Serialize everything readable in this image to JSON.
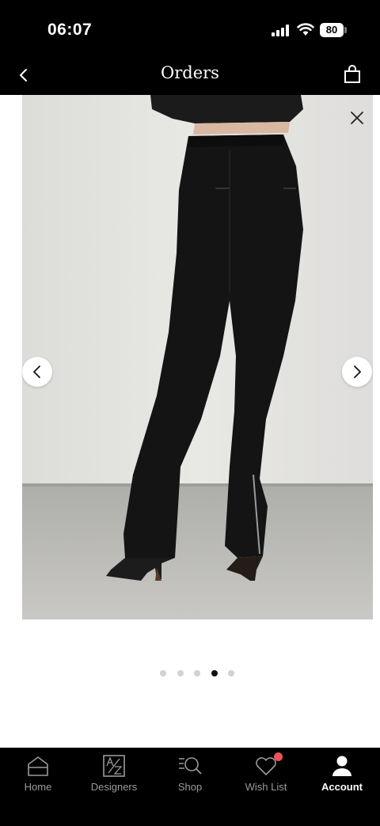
{
  "status_bar": {
    "time": "06:07",
    "battery": "80",
    "icons": [
      "signal-icon",
      "wifi-icon",
      "battery-icon"
    ]
  },
  "nav": {
    "title": "Orders",
    "back_icon": "chevron-left-icon",
    "bag_icon": "shopping-bag-icon"
  },
  "gallery": {
    "image_description_icon": "product-photo",
    "close_icon": "close-icon",
    "prev_icon": "chevron-left-icon",
    "next_icon": "chevron-right-icon",
    "total_images": 5,
    "active_index": 3
  },
  "tabs": [
    {
      "label": "Home",
      "icon": "home-icon",
      "active": false
    },
    {
      "label": "Designers",
      "icon": "a-z-icon",
      "active": false
    },
    {
      "label": "Shop",
      "icon": "search-list-icon",
      "active": false
    },
    {
      "label": "Wish List",
      "icon": "heart-icon",
      "active": false,
      "badge": true
    },
    {
      "label": "Account",
      "icon": "person-icon",
      "active": true
    }
  ],
  "colors": {
    "background": "#000000",
    "content_background": "#ffffff",
    "badge": "#f0505a",
    "tab_inactive": "#9a9a9a",
    "dot_active": "#111111",
    "dot_inactive": "#d2d2d2"
  }
}
